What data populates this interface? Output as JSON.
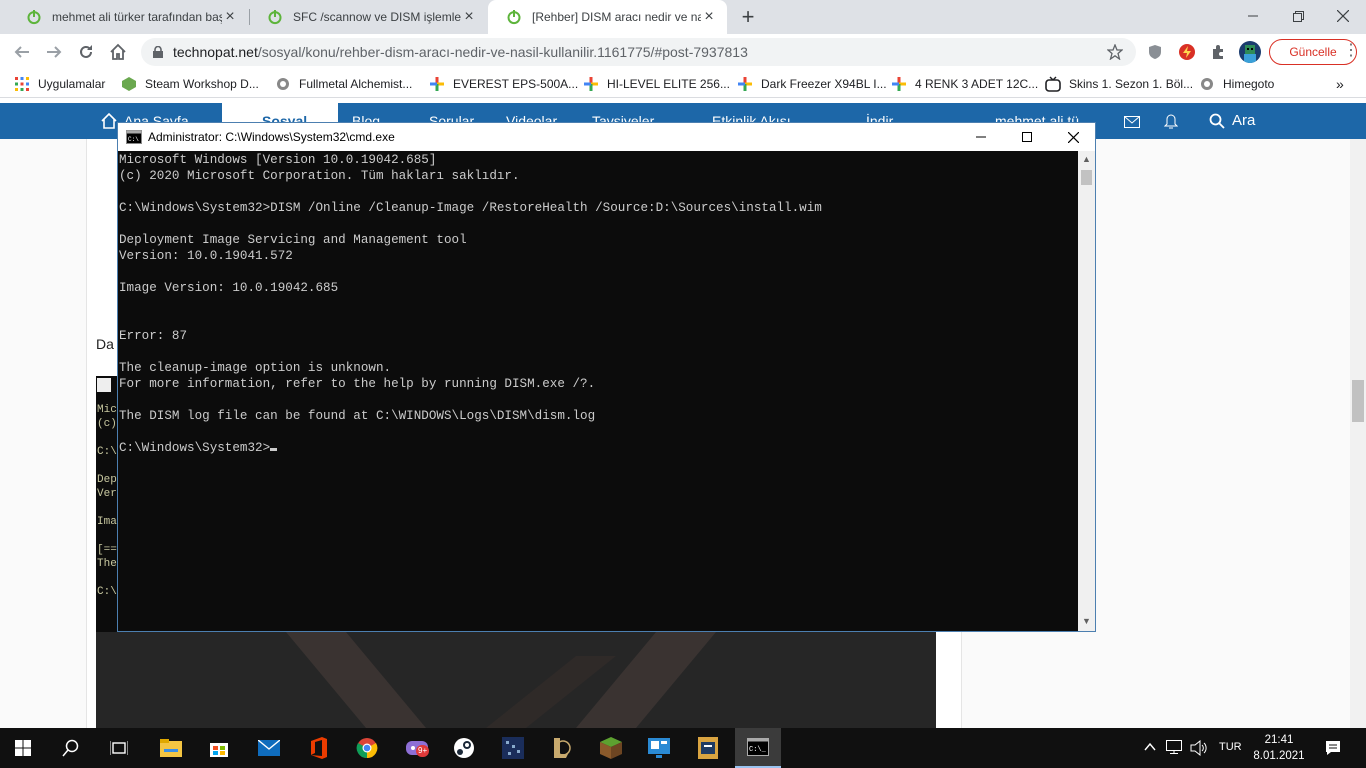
{
  "browser": {
    "tabs": [
      {
        "title": "mehmet ali türker tarafından başlatılan",
        "active": false
      },
      {
        "title": "SFC /scannow ve DISM işlemleri çözüm",
        "active": false
      },
      {
        "title": "[Rehber] DISM aracı nedir ve nasıl kullanılır",
        "active": true
      }
    ],
    "new_tab": "+",
    "url_host": "technopat.net",
    "url_path": "/sosyal/konu/rehber-dism-aracı-nedir-ve-nasil-kullanilir.1161775/#post-7937813",
    "update_label": "Güncelle",
    "bookmarks": [
      "Uygulamalar",
      "Steam Workshop D...",
      "Fullmetal Alchemist...",
      "EVEREST EPS-500A...",
      "HI-LEVEL ELITE 256...",
      "Dark Freezer X94BL I...",
      "4 RENK 3 ADET 12C...",
      "Skins 1. Sezon 1. Böl...",
      "Himegoto"
    ],
    "more_bookmarks": "»"
  },
  "site": {
    "nav": [
      "Ana Sayfa",
      "Sosyal",
      "Blog",
      "Sorular",
      "Videolar",
      "Tavsiyeler",
      "Etkinlik Akışı",
      "İndir"
    ],
    "user": "mehmet ali tü...",
    "search": "Ara",
    "partial_text": "Da",
    "embed_lines": [
      "Mic",
      "(c)",
      "C:\\",
      "Dep",
      "Ver",
      "Ima",
      "[==",
      "The",
      "C:\\"
    ]
  },
  "cmd": {
    "title": "Administrator: C:\\Windows\\System32\\cmd.exe",
    "lines": [
      "Microsoft Windows [Version 10.0.19042.685]",
      "(c) 2020 Microsoft Corporation. Tüm hakları saklıdır.",
      "",
      "C:\\Windows\\System32>DISM /Online /Cleanup-Image /RestoreHealth /Source:D:\\Sources\\install.wim",
      "",
      "Deployment Image Servicing and Management tool",
      "Version: 10.0.19041.572",
      "",
      "Image Version: 10.0.19042.685",
      "",
      "",
      "Error: 87",
      "",
      "The cleanup-image option is unknown.",
      "For more information, refer to the help by running DISM.exe /?.",
      "",
      "The DISM log file can be found at C:\\WINDOWS\\Logs\\DISM\\dism.log",
      ""
    ],
    "prompt": "C:\\Windows\\System32>"
  },
  "taskbar": {
    "lang": "TUR",
    "time": "21:41",
    "date": "8.01.2021",
    "badge": "9+"
  },
  "colors": {
    "site_nav": "#1d67a8",
    "chrome_tabs": "#dee1e6",
    "update_red": "#d93025",
    "taskbar": "#101010"
  }
}
